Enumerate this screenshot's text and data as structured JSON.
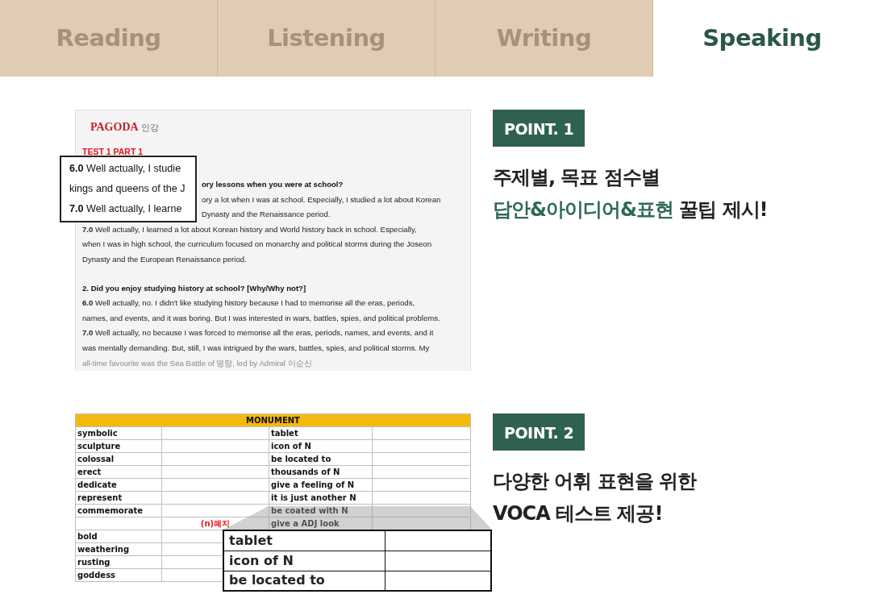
{
  "tabs": [
    {
      "label": "Reading",
      "selected": false
    },
    {
      "label": "Listening",
      "selected": false
    },
    {
      "label": "Writing",
      "selected": false
    },
    {
      "label": "Speaking",
      "selected": true
    }
  ],
  "sections": [
    {
      "kind": "document",
      "document": {
        "logo": "PAGODA",
        "logo_sub": "인강",
        "section_label": "TEST 1 PART 1",
        "blocks": [
          {
            "lines": [
              {
                "kind": "question",
                "text": "ory lessons when you were at school?",
                "covered": true
              },
              {
                "kind": "answer",
                "text": "ory a lot when I was at school. Especially, I studied a lot about Korean",
                "covered": true
              },
              {
                "kind": "answer",
                "text": "Dynasty and the Renaissance period.",
                "covered": true
              },
              {
                "kind": "answer",
                "text": "**7.0** Well actually, I learned a lot about Korean history and World history back in school. Especially,",
                "covered": false
              },
              {
                "kind": "answer",
                "text": "when I was in high school, the curriculum focused on monarchy and political storms during the Joseon",
                "covered": false
              },
              {
                "kind": "answer",
                "text": "Dynasty and the European Renaissance period.",
                "covered": false
              }
            ]
          },
          {
            "lines": [
              {
                "kind": "question",
                "text": "2. Did you enjoy studying history at school? [Why/Why not?]",
                "covered": false
              },
              {
                "kind": "answer",
                "text": "**6.0** Well actually, no. I didn't like studying history because I had to memorise all the eras, periods,",
                "covered": false
              },
              {
                "kind": "answer",
                "text": "names, and events, and it was boring. But I was interested in wars, battles, spies, and political problems.",
                "covered": false
              },
              {
                "kind": "answer",
                "text": "**7.0** Well actually, no because I was forced to memorise all the eras, periods, names, and events, and it",
                "covered": false
              },
              {
                "kind": "answer",
                "text": "was mentally demanding. But, still, I was intrigued by the wars, battles, spies, and political storms. My",
                "covered": false
              },
              {
                "kind": "answer",
                "text": "all-time favourite was the Sea Battle of 명량, led by Admiral 이순신",
                "covered": false
              }
            ]
          }
        ],
        "magnifier": {
          "lines": [
            "**6.0** Well actually, I studie",
            "kings and queens of the J",
            "**7.0** Well actually, I learne"
          ]
        }
      },
      "point": {
        "badge": "POINT. 1",
        "headline": [
          [
            {
              "text": "주제별, 목표 점수별",
              "accent": false
            }
          ],
          [
            {
              "text": "답안&아이디어&표현",
              "accent": true
            },
            {
              "text": " 꿀팁 제시!",
              "accent": false
            }
          ]
        ]
      }
    },
    {
      "kind": "vocab",
      "vocab": {
        "title": "MONUMENT",
        "rows": [
          {
            "word": "symbolic",
            "phrase": "tablet"
          },
          {
            "word": "sculpture",
            "phrase": "icon of N"
          },
          {
            "word": "colossal",
            "phrase": "be located to"
          },
          {
            "word": "erect",
            "phrase": "thousands of N"
          },
          {
            "word": "dedicate",
            "phrase": "give a feeling of N"
          },
          {
            "word": "represent",
            "phrase": "it is just another N"
          },
          {
            "word": "commemorate",
            "phrase": "be coated with N"
          },
          {
            "note": "(n)폐지",
            "phrase": "give a ADJ look"
          },
          {
            "word": "bold"
          },
          {
            "word": "weathering"
          },
          {
            "word": "rusting"
          },
          {
            "word": "goddess"
          }
        ],
        "magnifier": {
          "rows": [
            "tablet",
            "icon of N",
            "be located to"
          ]
        }
      },
      "point": {
        "badge": "POINT. 2",
        "headline": [
          [
            {
              "text": "다양한 어휘 표현을 위한",
              "accent": false
            }
          ],
          [
            {
              "text": "VOCA 테스트 제공!",
              "accent": false
            }
          ]
        ]
      }
    }
  ]
}
